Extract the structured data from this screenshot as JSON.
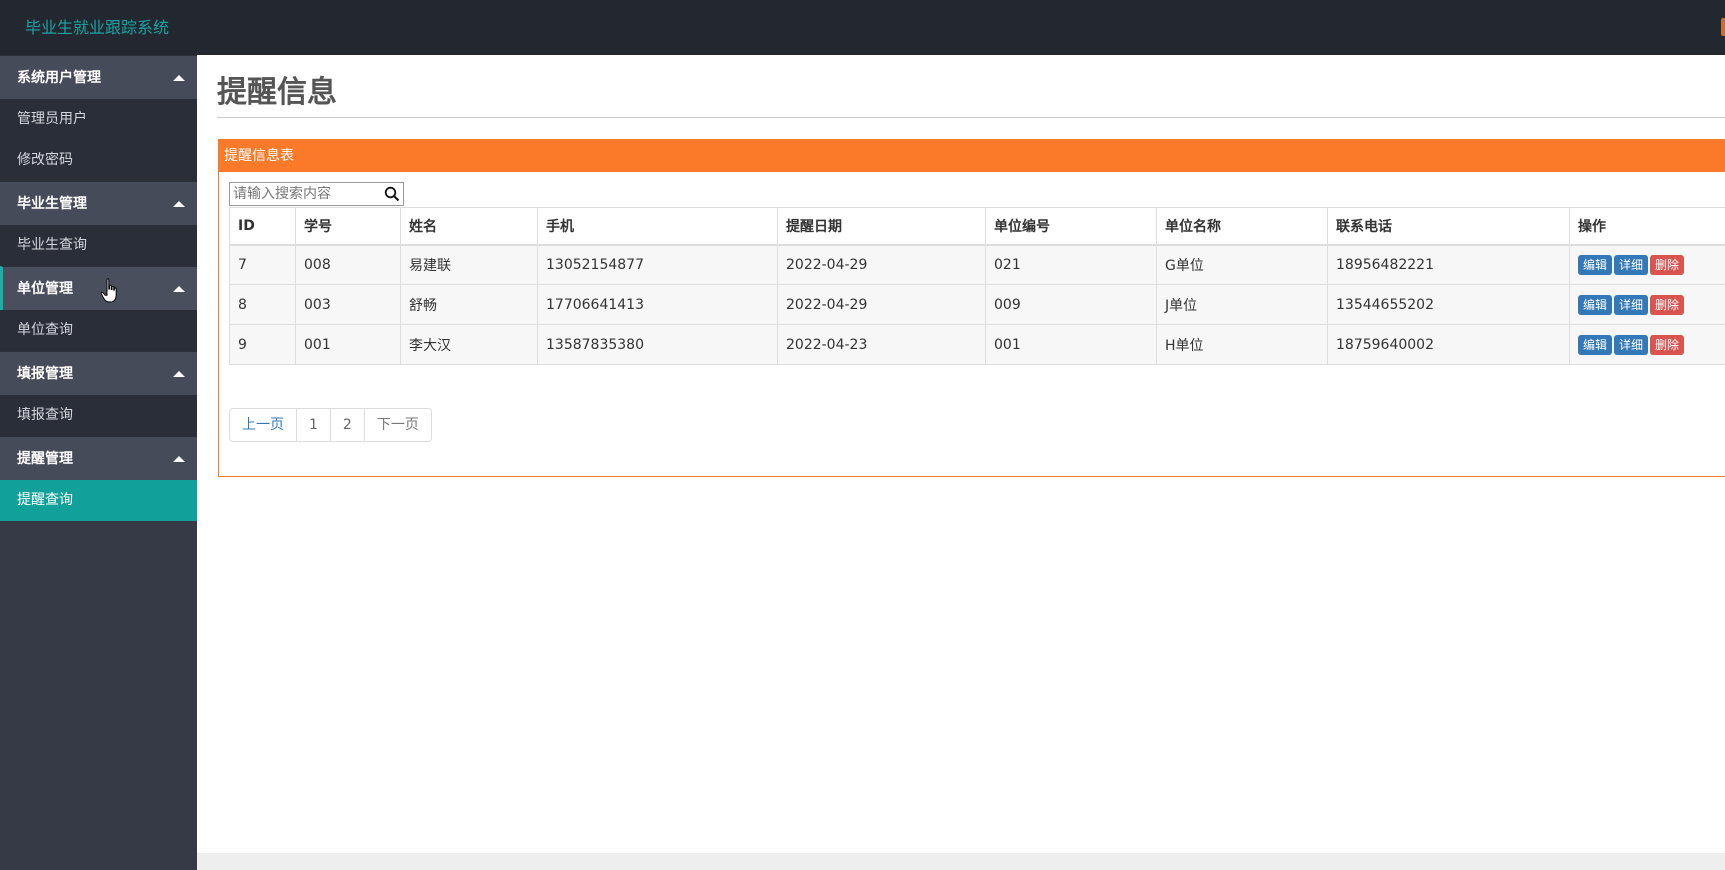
{
  "app": {
    "title": "毕业生就业跟踪系统"
  },
  "sidebar": {
    "groups": [
      {
        "label": "系统用户管理",
        "items": [
          "管理员用户",
          "修改密码"
        ]
      },
      {
        "label": "毕业生管理",
        "items": [
          "毕业生查询"
        ]
      },
      {
        "label": "单位管理",
        "items": [
          "单位查询"
        ]
      },
      {
        "label": "填报管理",
        "items": [
          "填报查询"
        ]
      },
      {
        "label": "提醒管理",
        "items": [
          "提醒查询"
        ]
      }
    ]
  },
  "page": {
    "title": "提醒信息"
  },
  "panel": {
    "heading": "提醒信息表"
  },
  "search": {
    "placeholder": "请输入搜索内容"
  },
  "table": {
    "columns": [
      "ID",
      "学号",
      "姓名",
      "手机",
      "提醒日期",
      "单位编号",
      "单位名称",
      "联系电话",
      "操作"
    ],
    "rows": [
      [
        "7",
        "008",
        "易建联",
        "13052154877",
        "2022-04-29",
        "021",
        "G单位",
        "18956482221"
      ],
      [
        "8",
        "003",
        "舒畅",
        "17706641413",
        "2022-04-29",
        "009",
        "J单位",
        "13544655202"
      ],
      [
        "9",
        "001",
        "李大汉",
        "13587835380",
        "2022-04-23",
        "001",
        "H单位",
        "18759640002"
      ]
    ],
    "actions": {
      "edit": "编辑",
      "detail": "详细",
      "delete": "删除"
    }
  },
  "pager": {
    "prev": "上一页",
    "pages": [
      "1",
      "2"
    ],
    "next": "下一页"
  },
  "colors": {
    "accent": "#fa7a2a",
    "teal": "#11a09a",
    "sidebar": "#363a46"
  }
}
